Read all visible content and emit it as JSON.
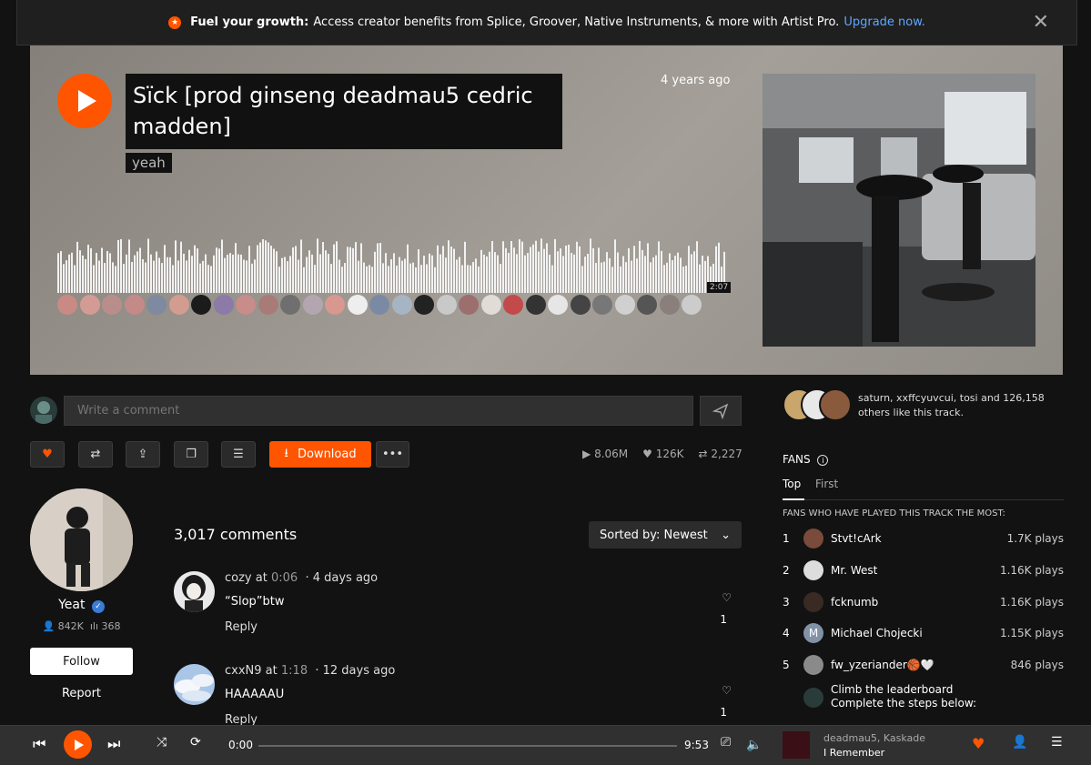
{
  "banner": {
    "bold": "Fuel your growth:",
    "text": "Access creator benefits from Splice, Groover, Native Instruments, & more with Artist Pro.",
    "link": "Upgrade now."
  },
  "track": {
    "title": "Sïck [prod ginseng deadmau5 cedric madden]",
    "artist": "yeah",
    "posted": "4 years ago",
    "waveform_time": "2:07"
  },
  "comment_box": {
    "placeholder": "Write a comment"
  },
  "actions": {
    "download_label": "Download"
  },
  "stats": {
    "plays": "8.06M",
    "likes": "126K",
    "reposts": "2,227"
  },
  "uploader": {
    "name": "Yeat",
    "followers": "842K",
    "tracks": "368",
    "follow_label": "Follow",
    "report_label": "Report"
  },
  "comments": {
    "count": "3,017 comments",
    "sort_label": "Sorted by: Newest",
    "items": [
      {
        "user": "cozy",
        "at": "at",
        "time": "0:06",
        "ago": "4 days ago",
        "text": "“Slop”btw",
        "reply": "Reply",
        "likes": "1"
      },
      {
        "user": "cxxN9",
        "at": "at",
        "time": "1:18",
        "ago": "12 days ago",
        "text": "HAAAAAU",
        "reply": "Reply",
        "likes": "1"
      }
    ]
  },
  "likes": {
    "text": "saturn, xxffcyuvcui, tosi and 126,158 others like this track."
  },
  "fans": {
    "title": "FANS",
    "tabs": [
      "Top",
      "First"
    ],
    "heading": "FANS WHO HAVE PLAYED THIS TRACK THE MOST:",
    "items": [
      {
        "rank": "1",
        "name": "Stvt!cArk",
        "plays": "1.7K plays"
      },
      {
        "rank": "2",
        "name": "Mr. West",
        "plays": "1.16K plays"
      },
      {
        "rank": "3",
        "name": "fcknumb",
        "plays": "1.16K plays"
      },
      {
        "rank": "4",
        "name": "Michael Chojecki",
        "plays": "1.15K plays",
        "initial": "M"
      },
      {
        "rank": "5",
        "name": "fw_yzeriander🏀🤍",
        "plays": "846 plays"
      }
    ],
    "climb_line1": "Climb the leaderboard",
    "climb_line2": "Complete the steps below:"
  },
  "player": {
    "current": "0:00",
    "duration": "9:53",
    "now_artist": "deadmau5, Kaskade",
    "now_title": "I Remember"
  },
  "colors": {
    "accent": "#ff5500",
    "link": "#5ea7ff"
  }
}
